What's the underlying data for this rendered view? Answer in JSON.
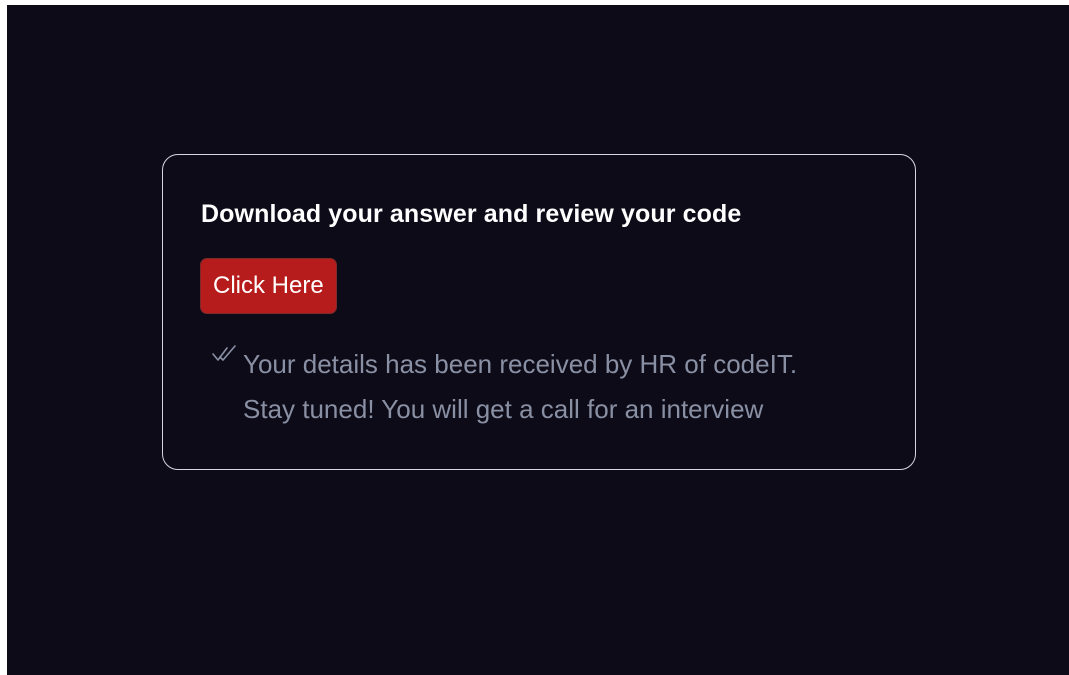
{
  "card": {
    "title": "Download your answer and review your code",
    "button_label": "Click Here",
    "message_line1": "Your details has been received by HR of codeIT.",
    "message_line2": "Stay tuned! You will get a call for an interview",
    "check_icon": "double-check-icon"
  },
  "colors": {
    "background": "#0d0b18",
    "card_border": "#d7d6df",
    "title_text": "#ffffff",
    "button_background": "#b71c1c",
    "message_text": "#8a90a4"
  }
}
